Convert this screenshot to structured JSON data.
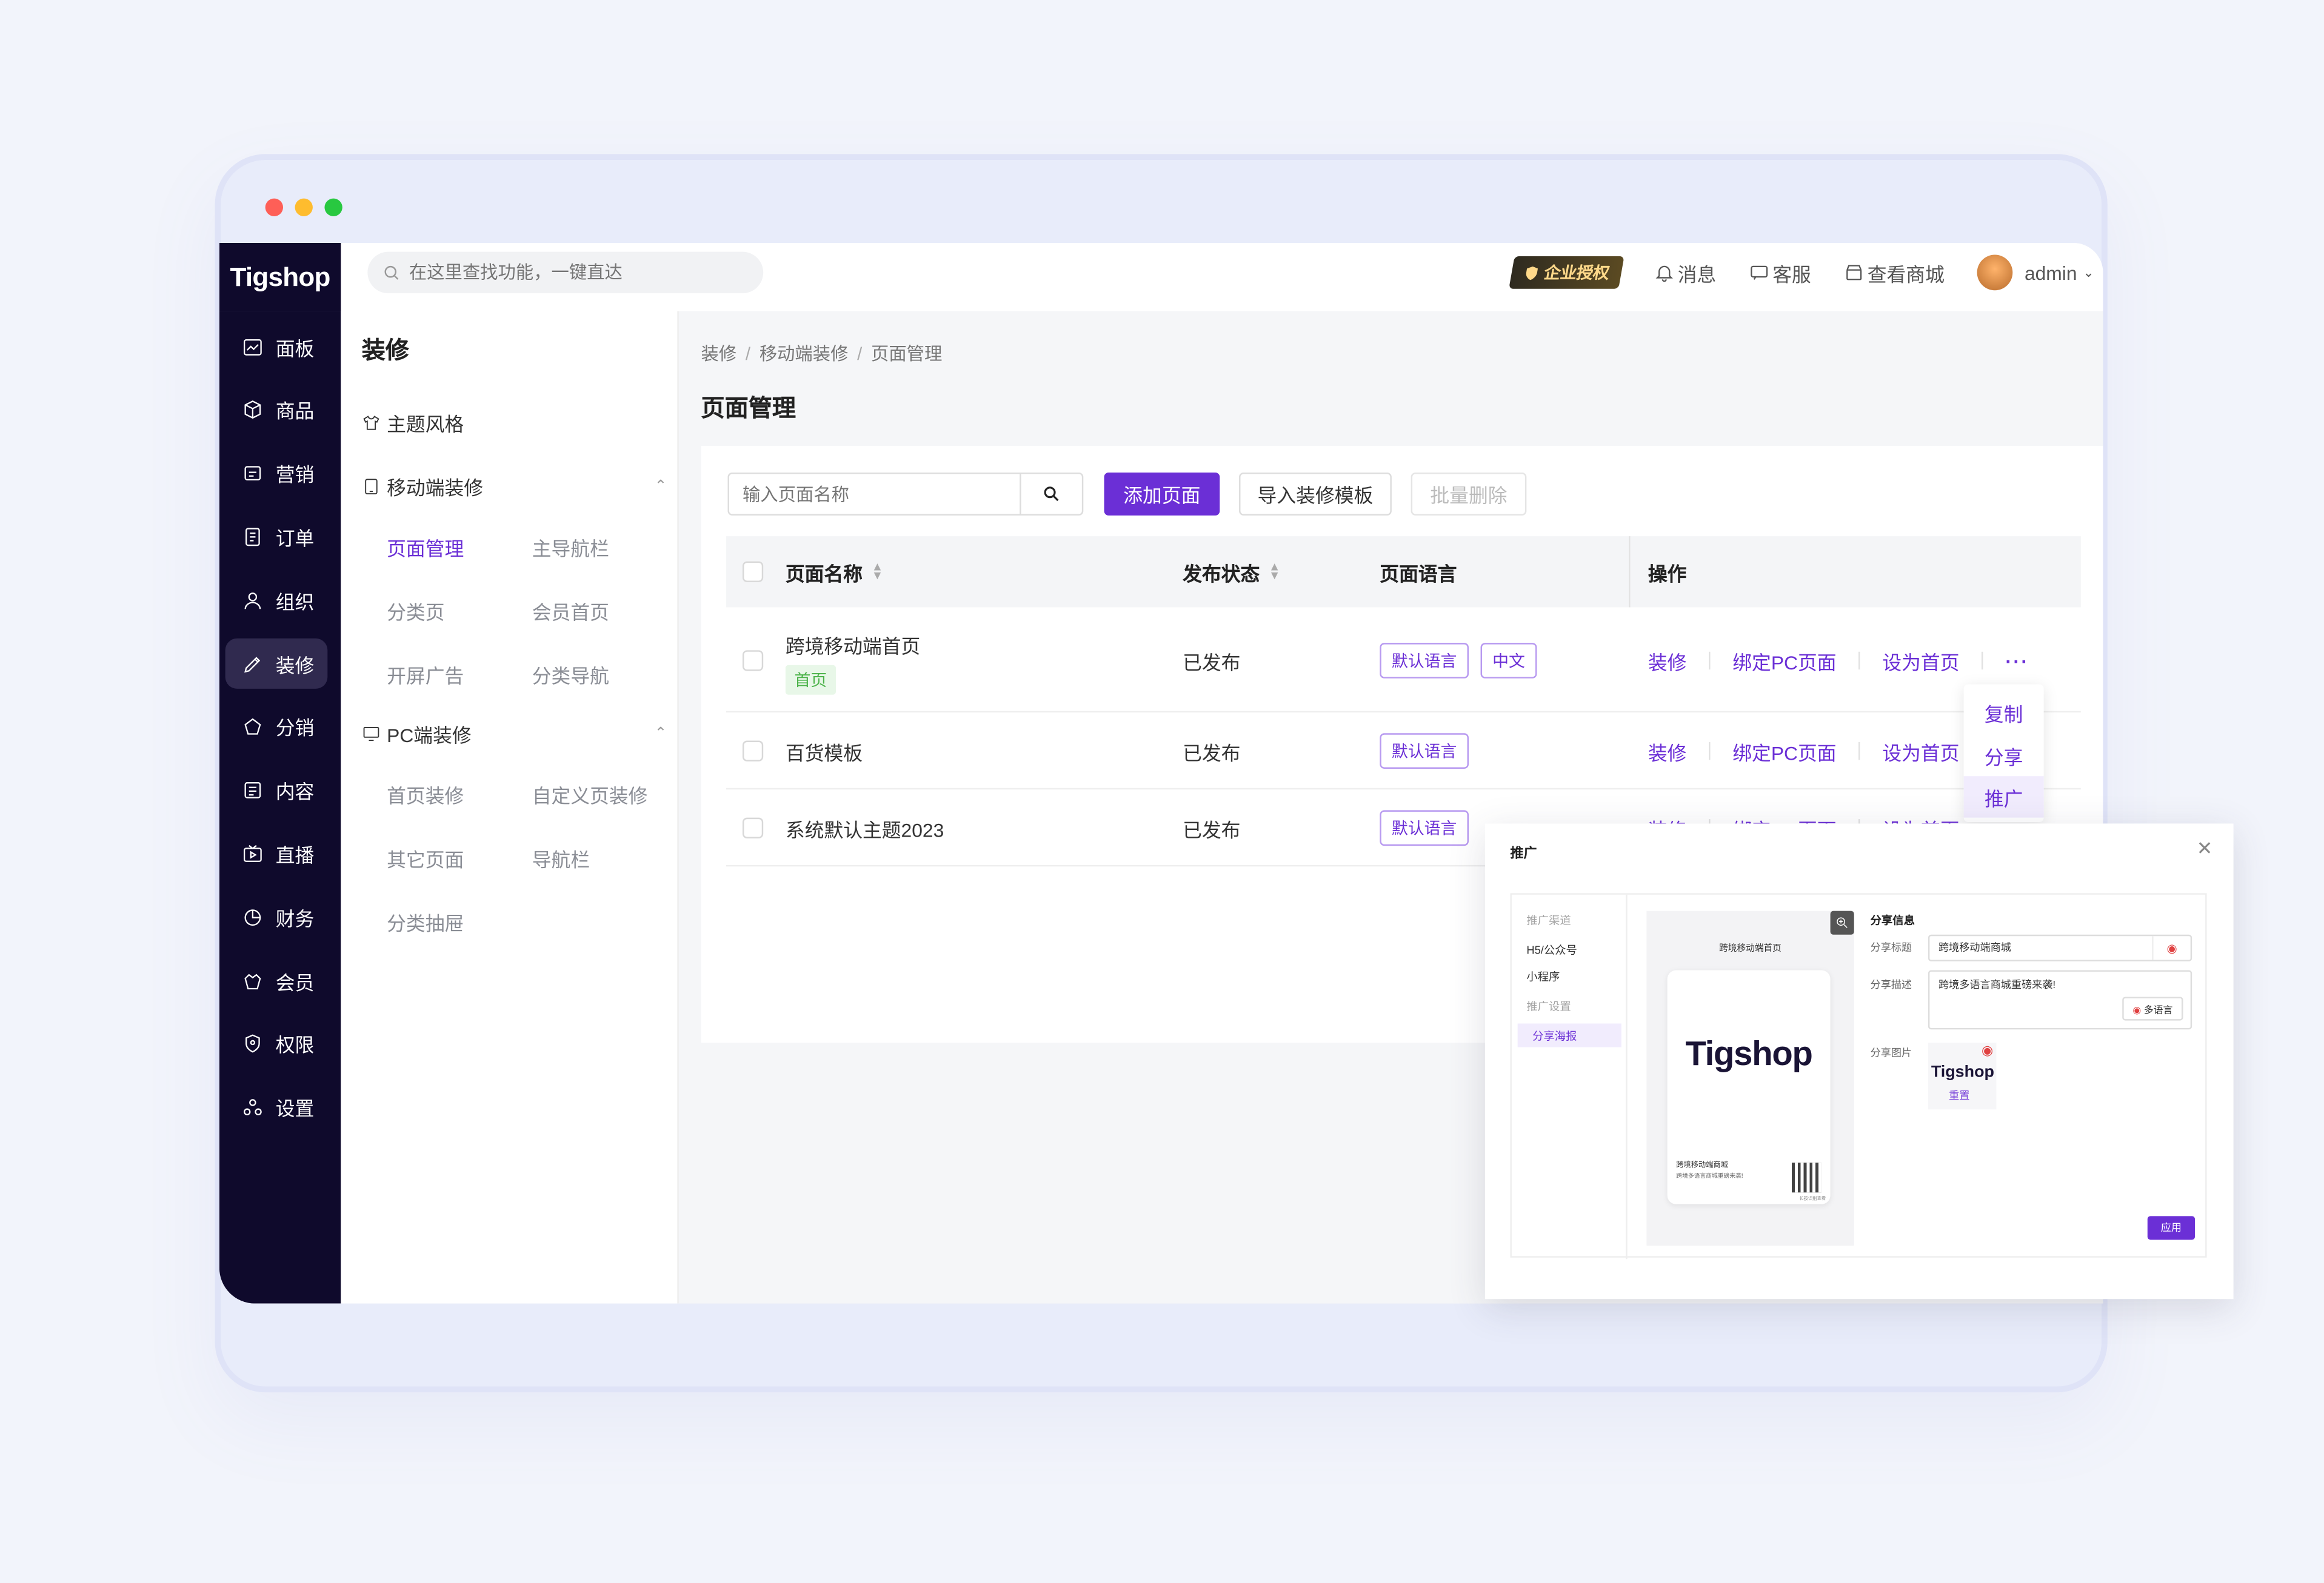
{
  "colors": {
    "accent": "#6b2fd6",
    "nav_bg": "#0f0a2c",
    "home_tag_green": "#4cb34a"
  },
  "brand": {
    "logo": "Tigshop"
  },
  "topbar": {
    "search_placeholder": "在这里查找功能，一键直达",
    "auth_badge": "企业授权",
    "messages": "消息",
    "service": "客服",
    "view_shop": "查看商城",
    "user": "admin"
  },
  "nav": {
    "items": [
      {
        "label": "面板",
        "icon": "dashboard-icon"
      },
      {
        "label": "商品",
        "icon": "box-icon"
      },
      {
        "label": "营销",
        "icon": "marketing-icon"
      },
      {
        "label": "订单",
        "icon": "order-icon"
      },
      {
        "label": "组织",
        "icon": "org-icon"
      },
      {
        "label": "装修",
        "icon": "brush-icon"
      },
      {
        "label": "分销",
        "icon": "distribution-icon"
      },
      {
        "label": "内容",
        "icon": "content-icon"
      },
      {
        "label": "直播",
        "icon": "live-icon"
      },
      {
        "label": "财务",
        "icon": "finance-icon"
      },
      {
        "label": "会员",
        "icon": "member-icon"
      },
      {
        "label": "权限",
        "icon": "permission-icon"
      },
      {
        "label": "设置",
        "icon": "settings-icon"
      }
    ]
  },
  "submenu": {
    "title": "装修",
    "theme": "主题风格",
    "mobile_section": "移动端装修",
    "mobile_links": [
      "页面管理",
      "主导航栏",
      "分类页",
      "会员首页",
      "开屏广告",
      "分类导航"
    ],
    "pc_section": "PC端装修",
    "pc_links": [
      "首页装修",
      "自定义页装修",
      "其它页面",
      "导航栏",
      "分类抽屉"
    ]
  },
  "breadcrumb": [
    "装修",
    "移动端装修",
    "页面管理"
  ],
  "page_title": "页面管理",
  "toolbar": {
    "search_placeholder": "输入页面名称",
    "add_page": "添加页面",
    "import_template": "导入装修模板",
    "batch_delete": "批量删除"
  },
  "table": {
    "headers": {
      "name": "页面名称",
      "status": "发布状态",
      "language": "页面语言",
      "ops": "操作"
    },
    "rows": [
      {
        "name": "跨境移动端首页",
        "home_tag": "首页",
        "status": "已发布",
        "langs": [
          "默认语言",
          "中文"
        ]
      },
      {
        "name": "百货模板",
        "home_tag": "",
        "status": "已发布",
        "langs": [
          "默认语言"
        ]
      },
      {
        "name": "系统默认主题2023",
        "home_tag": "",
        "status": "已发布",
        "langs": [
          "默认语言"
        ]
      }
    ],
    "ops": {
      "decorate": "装修",
      "bind_pc": "绑定PC页面",
      "set_home": "设为首页",
      "more": "···"
    }
  },
  "dropdown": [
    "复制",
    "分享",
    "推广"
  ],
  "modal": {
    "title": "推广",
    "side": {
      "channel_label": "推广渠道",
      "h5": "H5/公众号",
      "mini": "小程序",
      "setting_label": "推广设置",
      "poster": "分享海报"
    },
    "poster": {
      "header": "跨境移动端首页",
      "logo": "Tigshop",
      "shop": "跨境移动端商城",
      "desc": "跨境多语言商城重磅来袭!",
      "qr_caption": "长按识别查看"
    },
    "form": {
      "title": "分享信息",
      "share_title_label": "分享标题",
      "share_title_value": "跨境移动端商城",
      "share_desc_label": "分享描述",
      "share_desc_value": "跨境多语言商城重磅来袭!",
      "multi_lang": "多语言",
      "share_image_label": "分享图片",
      "thumb_logo": "Tigshop",
      "reset": "重置",
      "apply": "应用"
    }
  }
}
